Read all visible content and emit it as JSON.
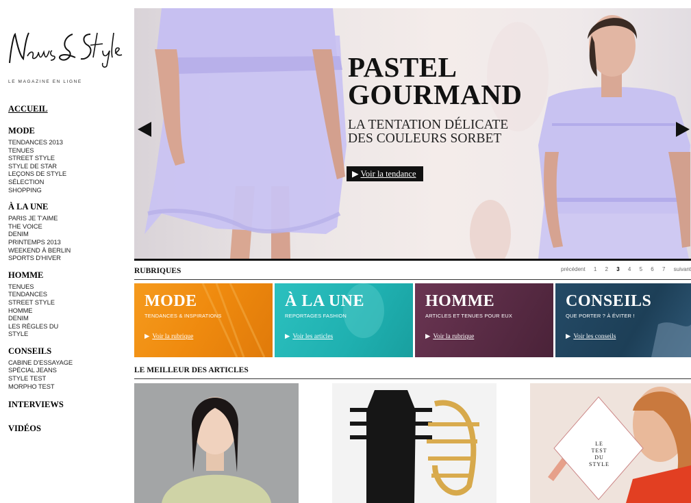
{
  "logo": {
    "text": "News & Style",
    "tagline": "LE MAGAZINE EN LIGNE"
  },
  "nav": {
    "home": "ACCUEIL",
    "sections": [
      {
        "title": "MODE",
        "items": [
          "TENDANCES 2013",
          "TENUES",
          "STREET STYLE",
          "STYLE DE STAR",
          "LEÇONS DE STYLE",
          "SÉLECTION SHOPPING"
        ]
      },
      {
        "title": "À LA UNE",
        "items": [
          "PARIS JE T'AIME",
          "THE VOICE",
          "DENIM",
          "PRINTEMPS 2013",
          "WEEKEND À BERLIN",
          "SPORTS D'HIVER"
        ]
      },
      {
        "title": "HOMME",
        "items": [
          "TENUES",
          "TENDANCES",
          "STREET STYLE HOMME",
          "DENIM",
          "LES RÈGLES DU STYLE"
        ]
      },
      {
        "title": "CONSEILS",
        "items": [
          "CABINE D'ESSAYAGE",
          "SPÉCIAL JEANS",
          "STYLE TEST",
          "MORPHO TEST"
        ]
      },
      {
        "title": "INTERVIEWS",
        "items": []
      },
      {
        "title": "VIDÉOS",
        "items": []
      }
    ]
  },
  "hero": {
    "title_line1": "PASTEL",
    "title_line2": "GOURMAND",
    "subtitle_line1": "LA TENTATION DÉLICATE",
    "subtitle_line2": "DES COULEURS SORBET",
    "cta": "Voir la tendance",
    "cta_icon": "play-triangle-icon"
  },
  "rubriques": {
    "title": "RUBRIQUES",
    "pager": {
      "prev": "précédent",
      "pages": [
        "1",
        "2",
        "3",
        "4",
        "5",
        "6",
        "7"
      ],
      "current": "3",
      "next": "suivant"
    }
  },
  "tiles": [
    {
      "title": "MODE",
      "subtitle": "TENDANCES & INSPIRATIONS",
      "link": "Voir la rubrique",
      "color": "#f08a10"
    },
    {
      "title": "À LA UNE",
      "subtitle": "REPORTAGES FASHION",
      "link": "Voir les articles",
      "color": "#1fb3b3"
    },
    {
      "title": "HOMME",
      "subtitle": "ARTICLES ET TENUES POUR EUX",
      "link": "Voir la rubrique",
      "color": "#5a2a44"
    },
    {
      "title": "CONSEILS",
      "subtitle": "QUE PORTER ? À ÉVITER !",
      "link": "Voir les conseils",
      "color": "#1d3f57"
    }
  ],
  "articles": {
    "title": "LE MEILLEUR DES ARTICLES",
    "style_test_badge": "LE TEST DU STYLE"
  }
}
